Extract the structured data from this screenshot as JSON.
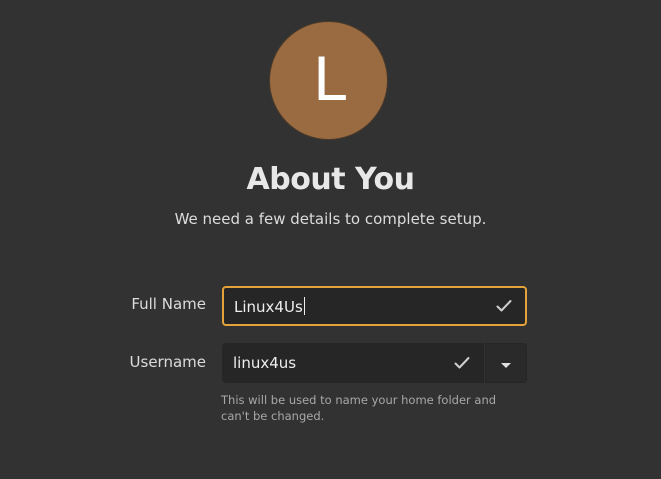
{
  "avatar": {
    "initial": "L",
    "color": "#9a6b40"
  },
  "header": {
    "title": "About You",
    "subtitle": "We need a few details to complete setup."
  },
  "form": {
    "full_name": {
      "label": "Full Name",
      "value": "Linux4Us",
      "status_icon": "checkmark-icon",
      "focused": true
    },
    "username": {
      "label": "Username",
      "value": "linux4us",
      "status_icon": "checkmark-icon",
      "dropdown_icon": "chevron-down-icon",
      "hint": "This will be used to name your home folder and can't be changed."
    }
  },
  "colors": {
    "background": "#323232",
    "focus_border": "#e6a23a",
    "field_background": "#262626"
  }
}
